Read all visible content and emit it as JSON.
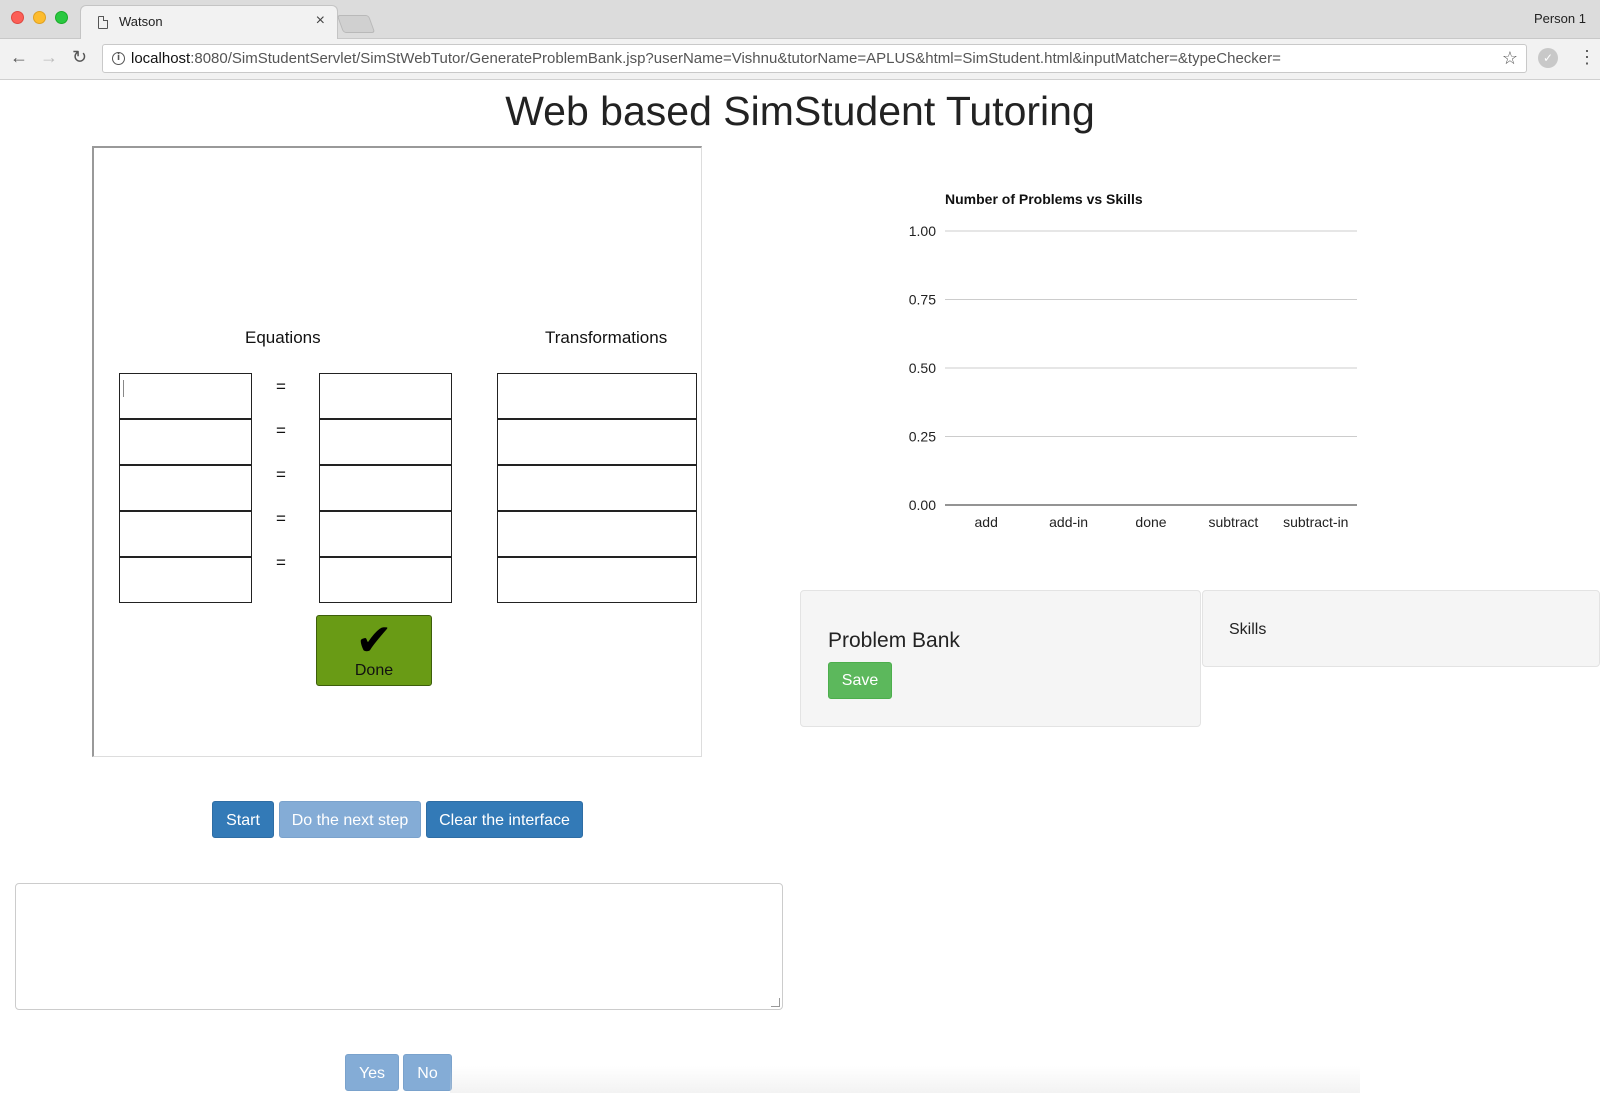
{
  "browser": {
    "tab_title": "Watson",
    "tab_close": "×",
    "profile": "Person 1",
    "url_host": "localhost",
    "url_rest": ":8080/SimStudentServlet/SimStWebTutor/GenerateProblemBank.jsp?userName=Vishnu&tutorName=APLUS&html=SimStudent.html&inputMatcher=&typeChecker=",
    "icons": [
      "back-icon",
      "forward-icon",
      "reload-icon",
      "info-icon",
      "star-icon",
      "extension-icon",
      "menu-icon"
    ]
  },
  "page": {
    "title": "Web based SimStudent Tutoring"
  },
  "tutor": {
    "equations_header": "Equations",
    "transformations_header": "Transformations",
    "equals_sign": "=",
    "rows": [
      {
        "left": "",
        "right": "",
        "transformation": ""
      },
      {
        "left": "",
        "right": "",
        "transformation": ""
      },
      {
        "left": "",
        "right": "",
        "transformation": ""
      },
      {
        "left": "",
        "right": "",
        "transformation": ""
      },
      {
        "left": "",
        "right": "",
        "transformation": ""
      }
    ],
    "done_icon": "✔",
    "done_label": "Done"
  },
  "controls": {
    "start": "Start",
    "next_step": "Do the next step",
    "clear": "Clear the interface",
    "yes": "Yes",
    "no": "No"
  },
  "message_box": {
    "value": ""
  },
  "problem_bank": {
    "title": "Problem Bank",
    "save": "Save"
  },
  "skills": {
    "title": "Skills"
  },
  "colors": {
    "primary": "#337ab7",
    "primary_disabled": "#84acd6",
    "success": "#5cb85c",
    "done_green": "#699b15"
  },
  "chart_data": {
    "type": "bar",
    "title": "Number of Problems vs Skills",
    "categories": [
      "add",
      "add-in",
      "done",
      "subtract",
      "subtract-in"
    ],
    "values": [
      0,
      0,
      0,
      0,
      0
    ],
    "yticks": [
      "1.00",
      "0.75",
      "0.50",
      "0.25",
      "0.00"
    ],
    "ylim": [
      0,
      1
    ],
    "grid": true,
    "xlabel": "",
    "ylabel": ""
  }
}
